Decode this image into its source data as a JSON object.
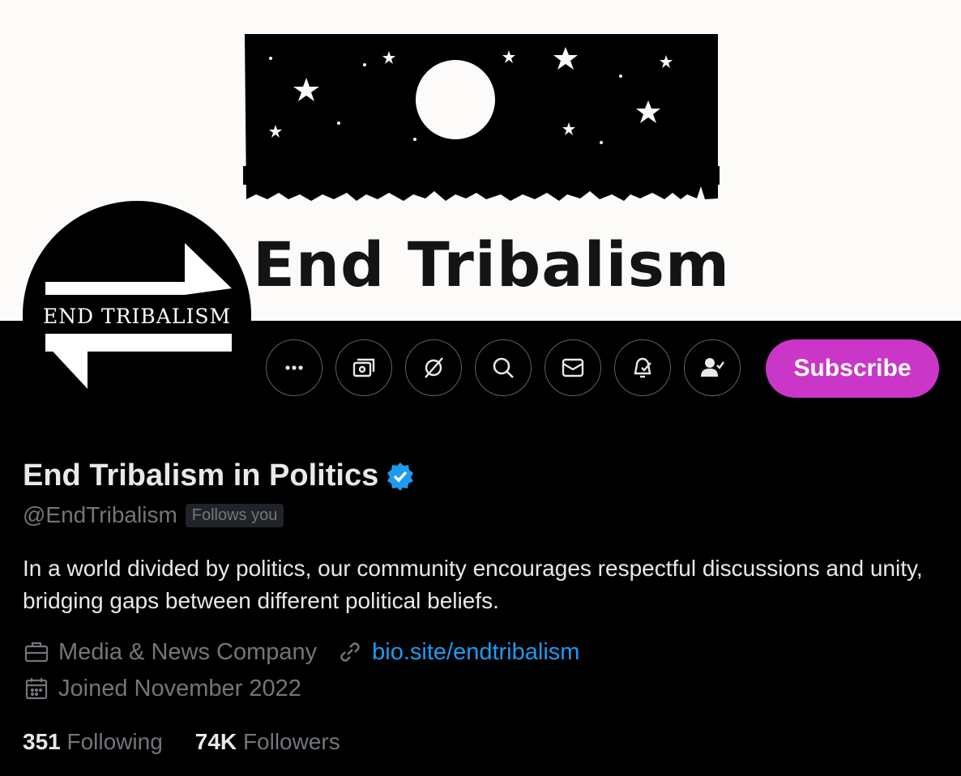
{
  "banner": {
    "text": "End Tribalism"
  },
  "avatar": {
    "text": "END TRIBALISM"
  },
  "actions": {
    "more_icon": "more-horizontal-icon",
    "tip_icon": "tip-money-icon",
    "grok_icon": "grok-icon",
    "search_icon": "search-icon",
    "message_icon": "mail-icon",
    "notify_icon": "bell-check-icon",
    "following_icon": "user-check-icon",
    "subscribe_label": "Subscribe"
  },
  "profile": {
    "display_name": "End Tribalism in Politics",
    "handle": "@EndTribalism",
    "follows_you": "Follows you",
    "bio": "In a world divided by politics, our community encourages respectful discussions and unity, bridging gaps between different political beliefs.",
    "category": "Media & News Company",
    "website": "bio.site/endtribalism",
    "joined": "Joined November 2022",
    "following_count": "351",
    "following_label": "Following",
    "followers_count": "74K",
    "followers_label": "Followers"
  },
  "colors": {
    "background": "#000000",
    "subscribe": "#c936c8",
    "link": "#1d9bf0",
    "verified": "#1d9bf0",
    "muted": "#71767b"
  }
}
